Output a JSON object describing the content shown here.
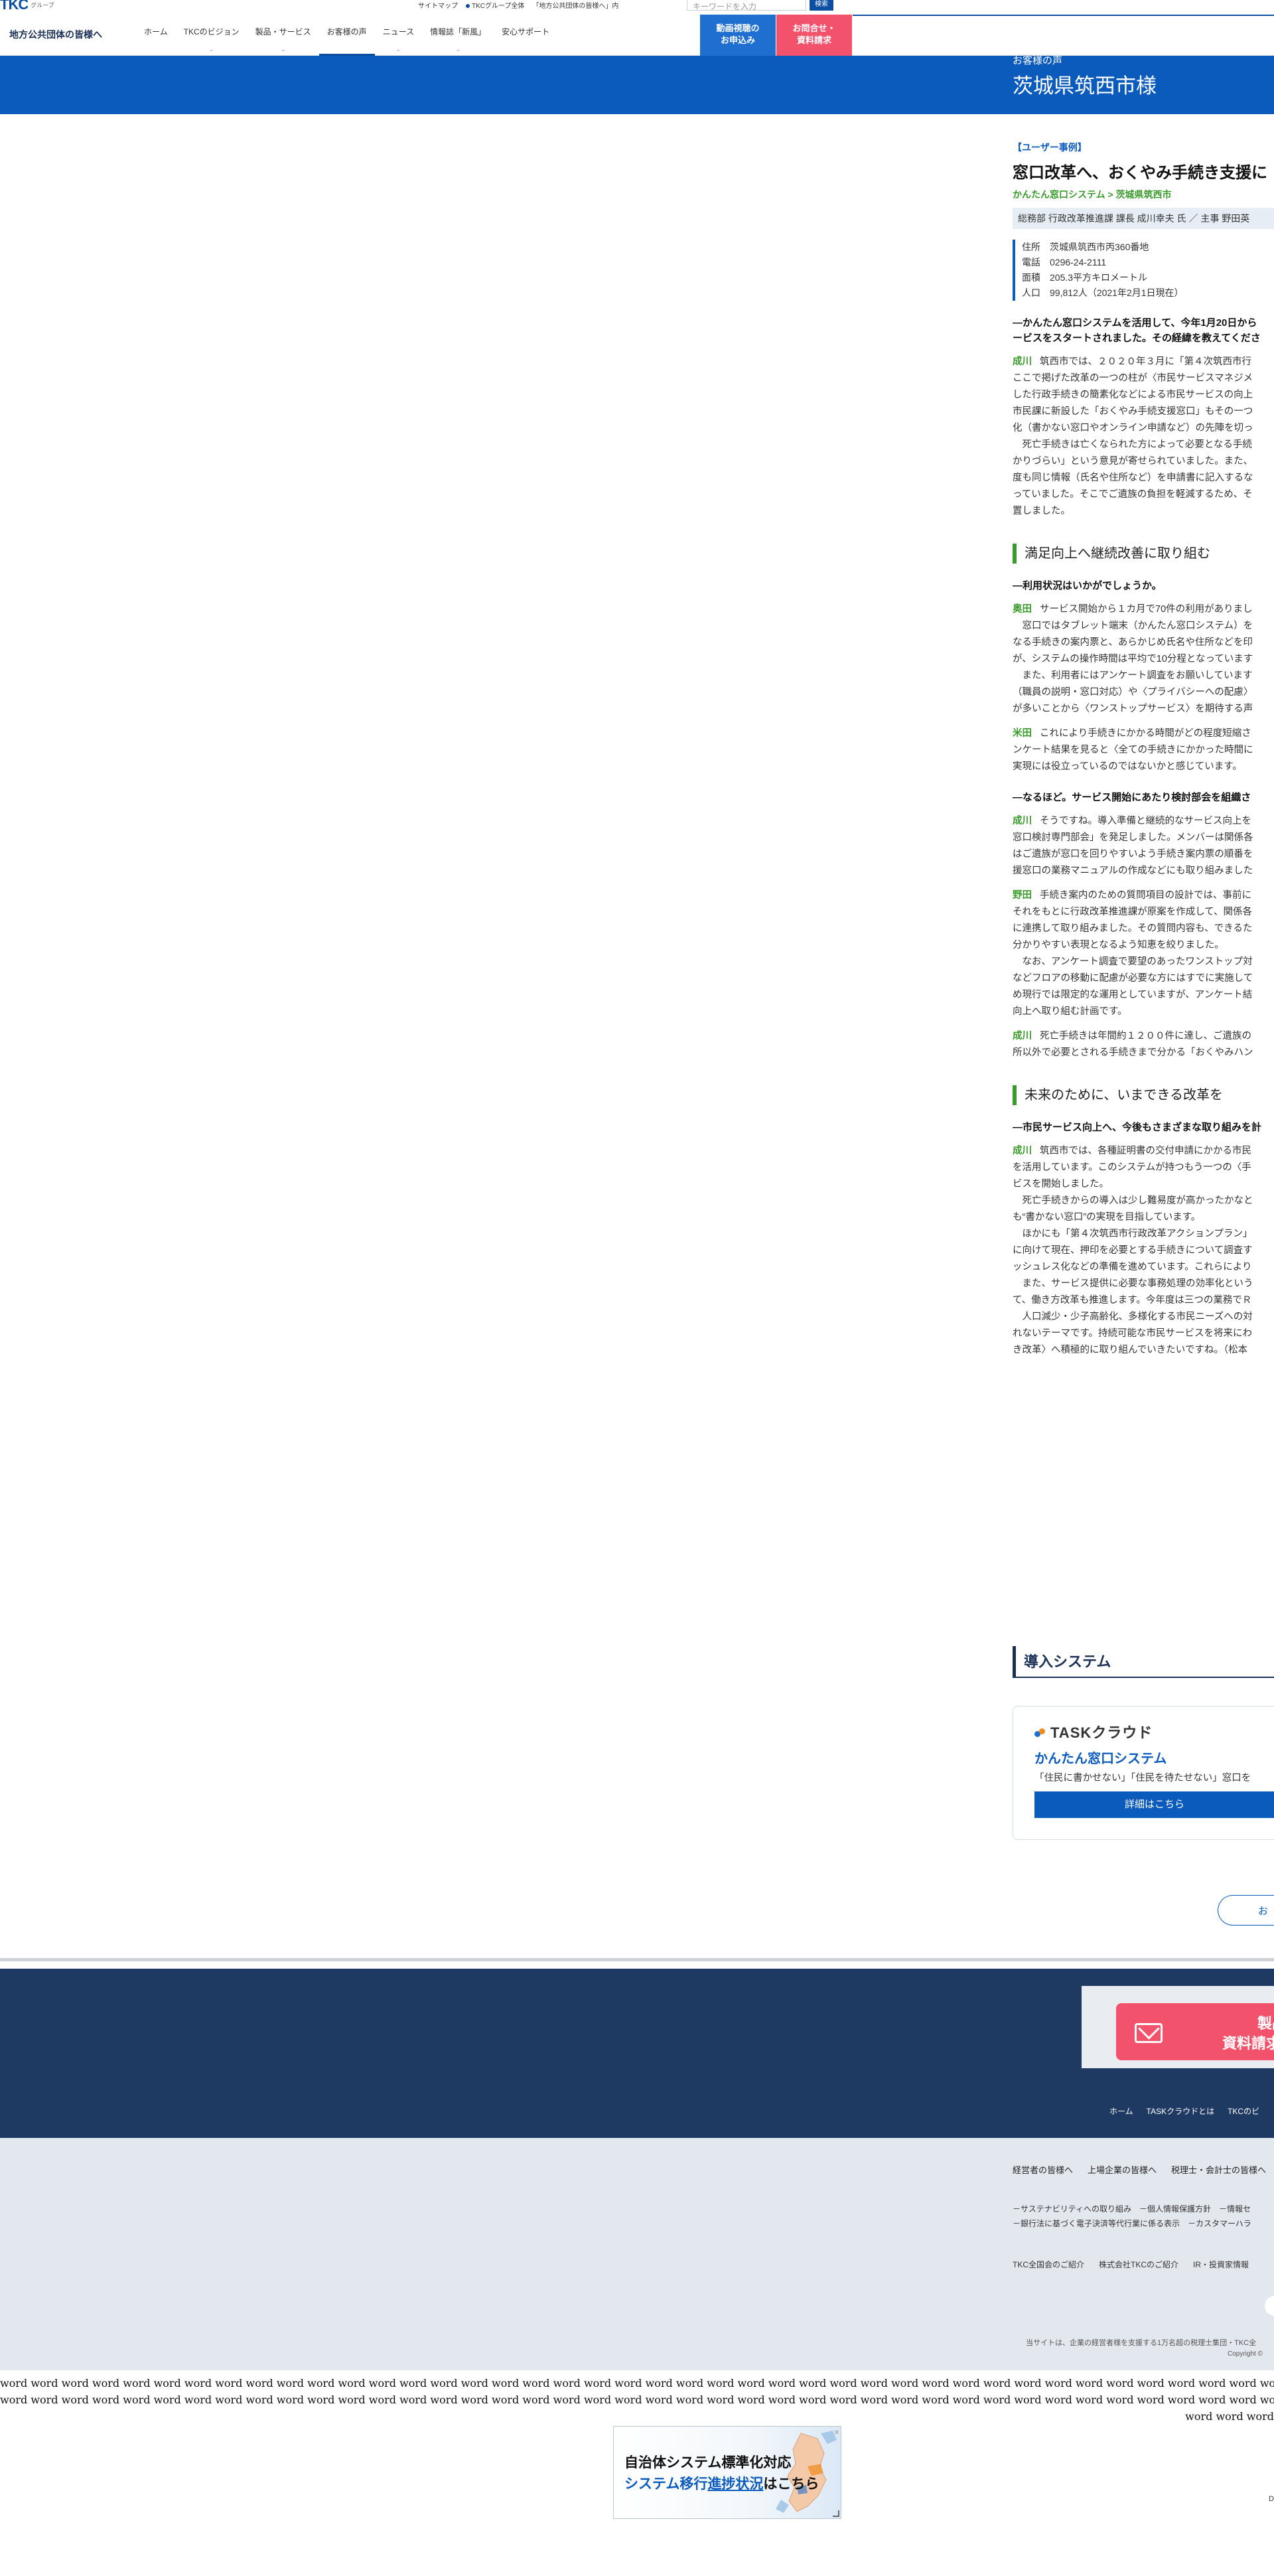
{
  "header": {
    "logo_text": "TKC",
    "logo_sub": "グループ",
    "top_links": [
      "サイトマップ",
      "TKCグループ全体",
      "「地方公共団体の皆様へ」内"
    ],
    "search_placeholder": "キーワードを入力",
    "search_button": "検索",
    "site_title": "地方公共団体の皆様へ",
    "nav": [
      {
        "label": "ホーム",
        "chev": ""
      },
      {
        "label": "TKCのビジョン",
        "chev": "⌄"
      },
      {
        "label": "製品・サービス",
        "chev": "⌄"
      },
      {
        "label": "お客様の声",
        "chev": ""
      },
      {
        "label": "ニュース",
        "chev": "⌄"
      },
      {
        "label": "情報誌「新風」",
        "chev": "⌄"
      },
      {
        "label": "安心サポート",
        "chev": ""
      }
    ],
    "btn_video": [
      "動画視聴の",
      "お申込み"
    ],
    "btn_contact": [
      "お問合せ・",
      "資料請求"
    ]
  },
  "hero": {
    "category": "お客様の声",
    "title": "茨城県筑西市様"
  },
  "article": {
    "tag": "【ユーザー事例】",
    "headline": "窓口改革へ、おくやみ手続き支援に",
    "breadcrumb": "かんたん窓口システム > 茨城県筑西市",
    "persons": "総務部 行政改革推進課 課長 成川幸夫 氏 ／ 主事 野田英",
    "info": [
      {
        "k": "住所",
        "v": "茨城県筑西市丙360番地"
      },
      {
        "k": "電話",
        "v": "0296-24-2111"
      },
      {
        "k": "面積",
        "v": "205.3平方キロメートル"
      },
      {
        "k": "人口",
        "v": "99,812人（2021年2月1日現在）"
      }
    ],
    "q1": [
      "―かんたん窓口システムを活用して、今年1月20日から",
      "ービスをスタートされました。その経緯を教えてくださ"
    ],
    "p1": [
      {
        "sp": "成川",
        "lines": [
          "筑西市では、２０２０年３月に「第４次筑西市行",
          "ここで掲げた改革の一つの柱が〈市民サービスマネジメ",
          "した行政手続きの簡素化などによる市民サービスの向上",
          "市民課に新設した「おくやみ手続支援窓口」もその一つ",
          "化（書かない窓口やオンライン申請など）の先陣を切っ",
          "　死亡手続きは亡くなられた方によって必要となる手続",
          "かりづらい」という意見が寄せられていました。また、",
          "度も同じ情報（氏名や住所など）を申請書に記入するな",
          "っていました。そこでご遺族の負担を軽減するため、そ",
          "置しました。"
        ]
      }
    ],
    "sec1": "満足向上へ継続改善に取り組む",
    "q2": [
      "―利用状況はいかがでしょうか。"
    ],
    "p2": [
      {
        "sp": "奥田",
        "lines": [
          "サービス開始から１カ月で70件の利用がありまし",
          "　窓口ではタブレット端末（かんたん窓口システム）を",
          "なる手続きの案内票と、あらかじめ氏名や住所などを印",
          "が、システムの操作時間は平均で10分程となっています",
          "　また、利用者にはアンケート調査をお願いしています",
          "（職員の説明・窓口対応）や〈プライバシーへの配慮〉",
          "が多いことから〈ワンストップサービス〉を期待する声"
        ]
      },
      {
        "sp": "米田",
        "lines": [
          "これにより手続きにかかる時間がどの程度短縮さ",
          "ンケート結果を見ると〈全ての手続きにかかった時間に",
          "実現には役立っているのではないかと感じています。"
        ]
      }
    ],
    "q3": [
      "―なるほど。サービス開始にあたり検討部会を組織さ"
    ],
    "p3": [
      {
        "sp": "成川",
        "lines": [
          "そうですね。導入準備と継続的なサービス向上を",
          "窓口検討専門部会」を発足しました。メンバーは関係各",
          "はご遺族が窓口を回りやすいよう手続き案内票の順番を",
          "援窓口の業務マニュアルの作成などにも取り組みました"
        ]
      },
      {
        "sp": "野田",
        "lines": [
          "手続き案内のための質問項目の設計では、事前に",
          "それをもとに行政改革推進課が原案を作成して、関係各",
          "に連携して取り組みました。その質問内容も、できるた",
          "分かりやすい表現となるよう知恵を絞りました。",
          "　なお、アンケート調査で要望のあったワンストップ対",
          "などフロアの移動に配慮が必要な方にはすでに実施して",
          "め現行では限定的な運用としていますが、アンケート結",
          "向上へ取り組む計画です。"
        ]
      },
      {
        "sp": "成川",
        "lines": [
          "死亡手続きは年間約１２００件に達し、ご遺族の",
          "所以外で必要とされる手続きまで分かる「おくやみハン"
        ]
      }
    ],
    "sec2": "未来のために、いまできる改革を",
    "q4": [
      "―市民サービス向上へ、今後もさまざまな取り組みを計"
    ],
    "p4": [
      {
        "sp": "成川",
        "lines": [
          "筑西市では、各種証明書の交付申請にかかる市民",
          "を活用しています。このシステムが持つもう一つの〈手",
          "ビスを開始しました。",
          "　死亡手続きからの導入は少し難易度が高かったかなと",
          "も“書かない窓口”の実現を目指しています。",
          "　ほかにも「第４次筑西市行政改革アクションプラン」",
          "に向けて現在、押印を必要とする手続きについて調査す",
          "ッシュレス化などの準備を進めています。これらにより",
          "　また、サービス提供に必要な事務処理の効率化という",
          "て、働き方改革も推進します。今年度は三つの業務でＲ",
          "　人口減少・少子高齢化、多様化する市民ニーズへの対",
          "れないテーマです。持続可能な市民サービスを将来にわ",
          "き改革〉へ積極的に取り組んでいきたいですね。（松本"
        ]
      }
    ]
  },
  "system": {
    "heading": "導入システム",
    "logo": "TASKクラウド",
    "name": "かんたん窓口システム",
    "desc": "「住民に書かせない」「住民を待たせない」窓口を",
    "button": "詳細はこちら"
  },
  "more_button": "お",
  "footer": {
    "cta_lines": [
      "製品",
      "資料請求や"
    ],
    "links": [
      "ホーム",
      "TASKクラウドとは",
      "TKCのビ"
    ]
  },
  "subfooter": {
    "row1": [
      "経営者の皆様へ",
      "上場企業の皆様へ",
      "税理士・会計士の皆様へ"
    ],
    "row2a": "－サステナビリティへの取り組み　－個人情報保護方針　－情報セ",
    "row2b": "－銀行法に基づく電子決済等代行業に係る表示　－カスタマーハラ",
    "row3": [
      "TKC全国会のご紹介",
      "株式会社TKCのご紹介",
      "IR・投資家情報"
    ],
    "note": "当サイトは、企業の経営者様を支援する1万名超の税理士集団・TKC全",
    "copyright": "Copyright ©"
  },
  "filler_word": "word",
  "banner": {
    "line1": "自治体システム標準化対応",
    "line2_prefix": "システム移行",
    "line2_underlined": "進捗状況",
    "line2_suffix": "はこちら",
    "close": "×"
  },
  "edge_mark": "D"
}
